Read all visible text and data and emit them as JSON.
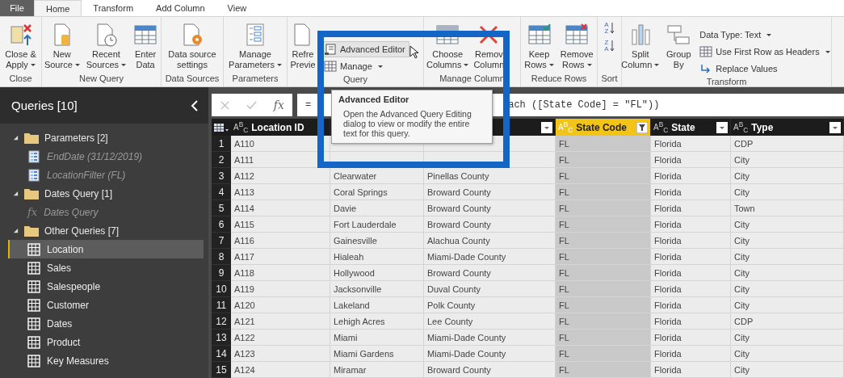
{
  "tabs": [
    {
      "label": "File",
      "kind": "file",
      "selected": false
    },
    {
      "label": "Home",
      "kind": "tab",
      "selected": true
    },
    {
      "label": "Transform",
      "kind": "tab",
      "selected": false
    },
    {
      "label": "Add Column",
      "kind": "tab",
      "selected": false
    },
    {
      "label": "View",
      "kind": "tab",
      "selected": false
    }
  ],
  "ribbon": {
    "groups": [
      {
        "label": "Close",
        "items": [
          {
            "kind": "large",
            "lines": [
              "Close &",
              "Apply"
            ],
            "dropdown": true
          }
        ]
      },
      {
        "label": "New Query",
        "items": [
          {
            "kind": "large",
            "lines": [
              "New",
              "Source"
            ],
            "dropdown": true
          },
          {
            "kind": "large",
            "lines": [
              "Recent",
              "Sources"
            ],
            "dropdown": true
          },
          {
            "kind": "large",
            "lines": [
              "Enter",
              "Data"
            ],
            "dropdown": false
          }
        ]
      },
      {
        "label": "Data Sources",
        "items": [
          {
            "kind": "large",
            "lines": [
              "Data source",
              "settings"
            ],
            "dropdown": false
          }
        ]
      },
      {
        "label": "Parameters",
        "items": [
          {
            "kind": "large",
            "lines": [
              "Manage",
              "Parameters"
            ],
            "dropdown": true
          }
        ]
      },
      {
        "label": "Query",
        "items": [
          {
            "kind": "large",
            "lines": [
              "Refre",
              "Previe"
            ],
            "dropdown": false
          },
          {
            "kind": "stack",
            "items": [
              {
                "label": "Advanced Editor",
                "dropdown": false,
                "hovered": true
              },
              {
                "label": "Manage",
                "dropdown": true,
                "hovered": false
              }
            ]
          }
        ]
      },
      {
        "label": "Manage Column",
        "items": [
          {
            "kind": "large",
            "lines": [
              "Choose",
              "Columns"
            ],
            "dropdown": true
          },
          {
            "kind": "large",
            "lines": [
              "Remov",
              "Column"
            ],
            "dropdown": false
          }
        ]
      },
      {
        "label": "Reduce Rows",
        "items": [
          {
            "kind": "large",
            "lines": [
              "Keep",
              "Rows"
            ],
            "dropdown": true
          },
          {
            "kind": "large",
            "lines": [
              "Remove",
              "Rows"
            ],
            "dropdown": true
          }
        ]
      },
      {
        "label": "Sort",
        "items": [
          {
            "kind": "sort",
            "first": "A",
            "last": "Z"
          },
          {
            "kind": "sort",
            "first": "Z",
            "last": "A"
          }
        ]
      },
      {
        "label": "Transform",
        "items": [
          {
            "kind": "large",
            "lines": [
              "Split",
              "Column"
            ],
            "dropdown": true
          },
          {
            "kind": "large",
            "lines": [
              "Group",
              "By"
            ],
            "dropdown": false
          },
          {
            "kind": "stack",
            "items": [
              {
                "label": "Data Type: Text",
                "dropdown": true,
                "hovered": false
              },
              {
                "label": "Use First Row as Headers",
                "dropdown": true,
                "hovered": false
              },
              {
                "label": "Replace Values",
                "dropdown": false,
                "hovered": false
              }
            ]
          }
        ]
      }
    ]
  },
  "tooltip": {
    "title": "Advanced Editor",
    "text": "Open the Advanced Query Editing dialog to view or modify the entire text for this query."
  },
  "queries": {
    "title": "Queries [10]",
    "groups": [
      {
        "label": "Parameters [2]",
        "expanded": true,
        "children": [
          {
            "label": "EndDate (31/12/2019)",
            "kind": "parameter",
            "selected": false
          },
          {
            "label": "LocationFilter (FL)",
            "kind": "parameter",
            "selected": false
          }
        ]
      },
      {
        "label": "Dates Query [1]",
        "expanded": true,
        "children": [
          {
            "label": "Dates Query",
            "kind": "function",
            "glyph": "fx",
            "selected": false
          }
        ]
      },
      {
        "label": "Other Queries [7]",
        "expanded": true,
        "children": [
          {
            "label": "Location",
            "kind": "table",
            "selected": true
          },
          {
            "label": "Sales",
            "kind": "table",
            "selected": false
          },
          {
            "label": "Salespeople",
            "kind": "table",
            "selected": false
          },
          {
            "label": "Customer",
            "kind": "table",
            "selected": false
          },
          {
            "label": "Dates",
            "kind": "table",
            "selected": false
          },
          {
            "label": "Product",
            "kind": "table",
            "selected": false
          },
          {
            "label": "Key Measures",
            "kind": "table",
            "selected": false
          }
        ]
      }
    ]
  },
  "formula": {
    "fx": "fx",
    "prefix": "=",
    "tail": "ach ([State Code] = \"FL\"))"
  },
  "table": {
    "columns": [
      {
        "type": "A$^{B}$$_{C}$",
        "name": "Location ID",
        "selected": false
      },
      {
        "selected": false
      },
      {
        "selected": false,
        "filtered": false
      },
      {
        "type": "A$^{B}$$_{C}$",
        "name": "State Code",
        "selected": true,
        "filtered": true
      },
      {
        "type": "A$^{B}$$_{C}$",
        "name": "State",
        "selected": false,
        "filtered": false
      },
      {
        "type": "A$^{B}$$_{C}$",
        "name": "Type",
        "selected": false,
        "filtered": false
      }
    ],
    "rows": [
      {
        "n": "1",
        "location_id": "A110",
        "state_code": "FL",
        "state": "Florida",
        "type": "CDP"
      },
      {
        "n": "2",
        "location_id": "A111",
        "state_code": "FL",
        "state": "Florida",
        "type": "City"
      },
      {
        "n": "3",
        "location_id": "A112",
        "column_2": "Clearwater",
        "column_3": "Pinellas County",
        "state_code": "FL",
        "state": "Florida",
        "type": "City"
      },
      {
        "n": "4",
        "location_id": "A113",
        "column_2": "Coral Springs",
        "column_3": "Broward County",
        "state_code": "FL",
        "state": "Florida",
        "type": "City"
      },
      {
        "n": "5",
        "location_id": "A114",
        "column_2": "Davie",
        "column_3": "Broward County",
        "state_code": "FL",
        "state": "Florida",
        "type": "Town"
      },
      {
        "n": "6",
        "location_id": "A115",
        "column_2": "Fort Lauderdale",
        "column_3": "Broward County",
        "state_code": "FL",
        "state": "Florida",
        "type": "City"
      },
      {
        "n": "7",
        "location_id": "A116",
        "column_2": "Gainesville",
        "column_3": "Alachua County",
        "state_code": "FL",
        "state": "Florida",
        "type": "City"
      },
      {
        "n": "8",
        "location_id": "A117",
        "column_2": "Hialeah",
        "column_3": "Miami-Dade County",
        "state_code": "FL",
        "state": "Florida",
        "type": "City"
      },
      {
        "n": "9",
        "location_id": "A118",
        "column_2": "Hollywood",
        "column_3": "Broward County",
        "state_code": "FL",
        "state": "Florida",
        "type": "City"
      },
      {
        "n": "10",
        "location_id": "A119",
        "column_2": "Jacksonville",
        "column_3": "Duval County",
        "state_code": "FL",
        "state": "Florida",
        "type": "City"
      },
      {
        "n": "11",
        "location_id": "A120",
        "column_2": "Lakeland",
        "column_3": "Polk County",
        "state_code": "FL",
        "state": "Florida",
        "type": "City"
      },
      {
        "n": "12",
        "location_id": "A121",
        "column_2": "Lehigh Acres",
        "column_3": "Lee County",
        "state_code": "FL",
        "state": "Florida",
        "type": "CDP"
      },
      {
        "n": "13",
        "location_id": "A122",
        "column_2": "Miami",
        "column_3": "Miami-Dade County",
        "state_code": "FL",
        "state": "Florida",
        "type": "City"
      },
      {
        "n": "14",
        "location_id": "A123",
        "column_2": "Miami Gardens",
        "column_3": "Miami-Dade County",
        "state_code": "FL",
        "state": "Florida",
        "type": "City"
      },
      {
        "n": "15",
        "location_id": "A124",
        "column_2": "Miramar",
        "column_3": "Broward County",
        "state_code": "FL",
        "state": "Florida",
        "type": "City"
      }
    ]
  }
}
